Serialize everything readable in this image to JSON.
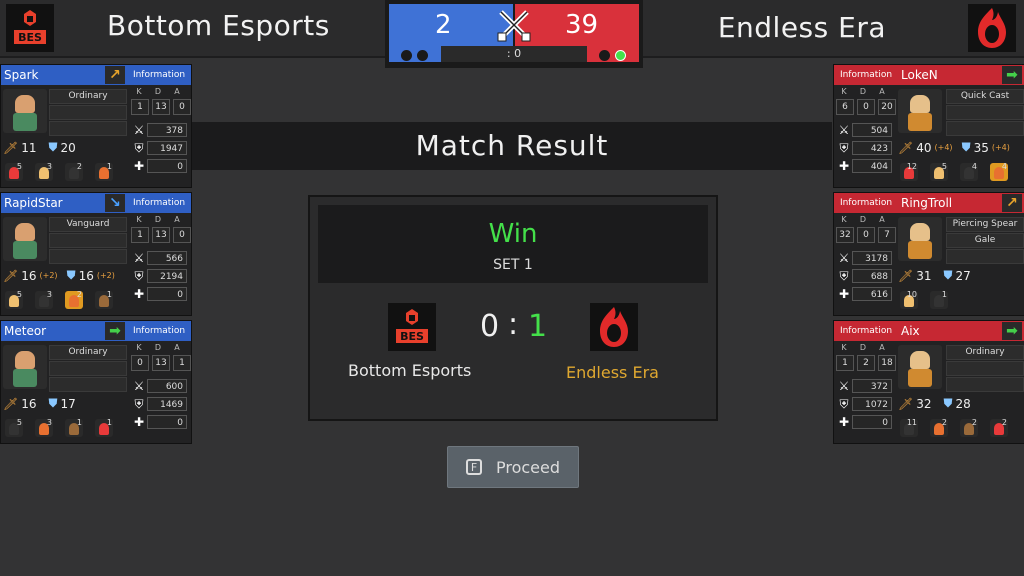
{
  "header": {
    "left_team": {
      "name": "Bottom Esports",
      "logo_text": "BES",
      "score": "2"
    },
    "right_team": {
      "name": "Endless Era",
      "score": "39"
    },
    "timer": ": 0",
    "colors": {
      "blue": "#3f72d6",
      "red": "#d9313b",
      "ready": "#44e04a"
    }
  },
  "banner": {
    "title": "Match Result"
  },
  "result": {
    "outcome": "Win",
    "set_label": "SET 1",
    "left_score": "0",
    "separator": ":",
    "right_score": "1",
    "left_name": "Bottom Esports",
    "right_name": "Endless Era",
    "left_logo_text": "BES"
  },
  "proceed": {
    "key": "F",
    "label": "Proceed"
  },
  "labels": {
    "info": "Information",
    "k": "K",
    "d": "D",
    "a": "A"
  },
  "blue_players": [
    {
      "name": "Spark",
      "arrow": "up-right",
      "arrow_icon": "↗",
      "arrow_color": "#e8a42a",
      "role1": "Ordinary",
      "role2": "",
      "k": "1",
      "d": "13",
      "a": "0",
      "atk": "11",
      "def": "20",
      "atk_bonus": "",
      "def_bonus": "",
      "dmg": "378",
      "taken": "1947",
      "heal": "0",
      "minis": [
        "5",
        "3",
        "2",
        "1"
      ],
      "hl": []
    },
    {
      "name": "RapidStar",
      "arrow": "down-right",
      "arrow_icon": "↘",
      "arrow_color": "#4aa0ff",
      "role1": "Vanguard",
      "role2": "",
      "k": "1",
      "d": "13",
      "a": "0",
      "atk": "16",
      "def": "16",
      "atk_bonus": "(+2)",
      "def_bonus": "(+2)",
      "dmg": "566",
      "taken": "2194",
      "heal": "0",
      "minis": [
        "5",
        "3",
        "2",
        "1"
      ],
      "hl": [
        2
      ]
    },
    {
      "name": "Meteor",
      "arrow": "right",
      "arrow_icon": "➡",
      "arrow_color": "#44d04a",
      "role1": "Ordinary",
      "role2": "",
      "k": "0",
      "d": "13",
      "a": "1",
      "atk": "16",
      "def": "17",
      "atk_bonus": "",
      "def_bonus": "",
      "dmg": "600",
      "taken": "1469",
      "heal": "0",
      "minis": [
        "5",
        "3",
        "1",
        "1"
      ],
      "hl": []
    }
  ],
  "red_players": [
    {
      "name": "LokeN",
      "arrow": "right",
      "arrow_icon": "➡",
      "arrow_color": "#44d04a",
      "role1": "Quick Cast",
      "role2": "",
      "k": "6",
      "d": "0",
      "a": "20",
      "atk": "40",
      "def": "35",
      "atk_bonus": "(+4)",
      "def_bonus": "(+4)",
      "dmg": "504",
      "taken": "423",
      "heal": "404",
      "minis": [
        "12",
        "5",
        "4",
        "4"
      ],
      "hl": [
        3
      ]
    },
    {
      "name": "RingTroll",
      "arrow": "up-right",
      "arrow_icon": "↗",
      "arrow_color": "#e8a42a",
      "role1": "Piercing Spear",
      "role2": "Gale",
      "k": "32",
      "d": "0",
      "a": "7",
      "atk": "31",
      "def": "27",
      "atk_bonus": "",
      "def_bonus": "",
      "dmg": "3178",
      "taken": "688",
      "heal": "616",
      "minis": [
        "10",
        "1"
      ],
      "hl": []
    },
    {
      "name": "Aix",
      "arrow": "right",
      "arrow_icon": "➡",
      "arrow_color": "#44d04a",
      "role1": "Ordinary",
      "role2": "",
      "k": "1",
      "d": "2",
      "a": "18",
      "atk": "32",
      "def": "28",
      "atk_bonus": "",
      "def_bonus": "",
      "dmg": "372",
      "taken": "1072",
      "heal": "0",
      "minis": [
        "11",
        "2",
        "2",
        "2"
      ],
      "hl": []
    }
  ]
}
